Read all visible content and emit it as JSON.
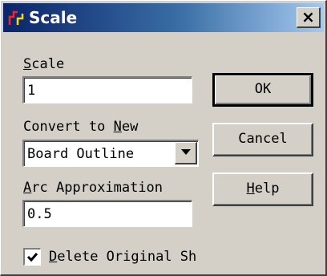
{
  "window": {
    "title": "Scale",
    "icon": "scale-tool-icon",
    "close_label": "×"
  },
  "scale": {
    "label_u": "S",
    "label_rest": "cale",
    "value": "1"
  },
  "convert": {
    "label_pre": "Convert to ",
    "label_u": "N",
    "label_rest": "ew",
    "selected": "Board Outline"
  },
  "arc": {
    "label_u": "A",
    "label_rest": "rc Approximation",
    "value": "0.5"
  },
  "delete_original": {
    "checked": true,
    "label_u": "D",
    "label_rest": "elete Original Sh"
  },
  "buttons": {
    "ok": "OK",
    "cancel": "Cancel",
    "help_u": "H",
    "help_rest": "elp"
  },
  "colors": {
    "title_start": "#0a246a",
    "title_end": "#a6caf0",
    "face": "#d4d0c8",
    "icon_red": "#ff2020",
    "icon_yellow": "#ffd800"
  }
}
